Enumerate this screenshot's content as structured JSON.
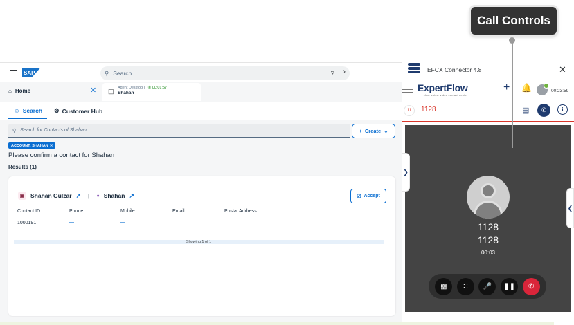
{
  "callout": {
    "label": "Call Controls"
  },
  "sap": {
    "logo_text": "SAP",
    "search_placeholder": "Search",
    "tabs": {
      "home_label": "Home",
      "agent_line1": "Agent Desktop |",
      "agent_timer": "00:01:57",
      "agent_line2": "Shahan"
    },
    "subtabs": {
      "search": "Search",
      "customer_hub": "Customer Hub"
    },
    "contact_search_placeholder": "Search for Contacts of Shahan",
    "create_label": "Create",
    "chip_label": "ACCOUNT: SHAHAN",
    "confirm_text": "Please confirm a contact for Shahan",
    "results_label": "Results (1)",
    "card": {
      "contact_name": "Shahan Gulzar",
      "separator": "|",
      "account_name": "Shahan",
      "accept_label": "Accept",
      "columns": [
        "Contact ID",
        "Phone",
        "Mobile",
        "Email",
        "Postal Address"
      ],
      "row": [
        "1000191",
        "—",
        "—",
        "—",
        "—"
      ],
      "paging": "Showing 1 of 1"
    }
  },
  "efcx": {
    "title": "EFCX Connector 4.8",
    "brand": "ExpertFlow",
    "brand_tagline": "chat. voice. video contact center",
    "timer": "00:23:59",
    "call_badge": "11",
    "call_number": "1128",
    "video": {
      "number_primary": "1128",
      "number_secondary": "1128",
      "duration": "00:03"
    },
    "controls": [
      "picture-in-picture",
      "dialpad",
      "mute-mic",
      "hold",
      "end-call"
    ]
  },
  "colors": {
    "sap_blue": "#0a6ed1",
    "brand_navy": "#1f3b6e",
    "call_red": "#d9362b",
    "end_call_red": "#d9253a",
    "online_green": "#6fb23f"
  }
}
